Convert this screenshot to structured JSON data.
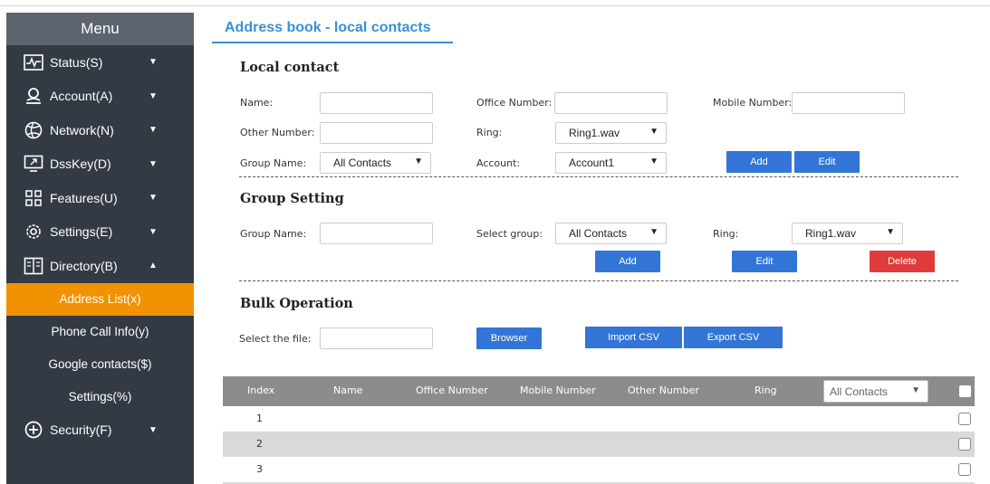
{
  "sidebar": {
    "menu_title": "Menu",
    "items": [
      {
        "label": "Status(S)",
        "icon": "status-icon"
      },
      {
        "label": "Account(A)",
        "icon": "account-icon"
      },
      {
        "label": "Network(N)",
        "icon": "network-icon"
      },
      {
        "label": "DssKey(D)",
        "icon": "dsskey-icon"
      },
      {
        "label": "Features(U)",
        "icon": "features-icon"
      },
      {
        "label": "Settings(E)",
        "icon": "settings-icon"
      },
      {
        "label": "Directory(B)",
        "icon": "directory-icon"
      }
    ],
    "directory_sub": [
      {
        "label": "Address List(x)",
        "active": true
      },
      {
        "label": "Phone Call Info(y)"
      },
      {
        "label": "Google contacts($)"
      },
      {
        "label": "Settings(%)"
      }
    ],
    "security": {
      "label": "Security(F)",
      "icon": "security-icon"
    },
    "active_color": "#f39200"
  },
  "page": {
    "title": "Address book - local contacts"
  },
  "local_contact": {
    "title": "Local contact",
    "name_label": "Name:",
    "office_label": "Office Number:",
    "mobile_label": "Mobile Number:",
    "other_label": "Other Number:",
    "ring_label": "Ring:",
    "ring_value": "Ring1.wav",
    "group_label": "Group Name:",
    "group_value": "All Contacts",
    "account_label": "Account:",
    "account_value": "Account1",
    "add_label": "Add",
    "edit_label": "Edit"
  },
  "group_setting": {
    "title": "Group Setting",
    "group_name_label": "Group Name:",
    "select_group_label": "Select group:",
    "select_group_value": "All Contacts",
    "ring_label": "Ring:",
    "ring_value": "Ring1.wav",
    "add_label": "Add",
    "edit_label": "Edit",
    "delete_label": "Delete"
  },
  "bulk": {
    "title": "Bulk Operation",
    "file_label": "Select the file:",
    "browser_label": "Browser",
    "import_label": "Import CSV",
    "export_label": "Export CSV"
  },
  "table": {
    "headers": [
      "Index",
      "Name",
      "Office Number",
      "Mobile Number",
      "Other Number",
      "Ring"
    ],
    "filter_value": "All Contacts",
    "rows": [
      {
        "index": "1"
      },
      {
        "index": "2"
      },
      {
        "index": "3"
      }
    ]
  },
  "colors": {
    "primary": "#3275d6",
    "danger": "#e03b3b",
    "title": "#3a8fd6",
    "sidebar": "#343a44"
  }
}
